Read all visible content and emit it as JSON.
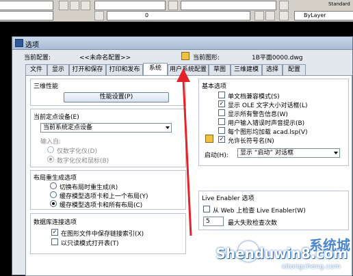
{
  "toolbar": {
    "layer_value": "0",
    "bylayer_label": "ByLayer",
    "standard_fragment": "Standard"
  },
  "dialog": {
    "title": "选项",
    "current_profile_label": "当前配置:",
    "current_profile_value": "<<未命名配置>>",
    "current_drawing_label": "当前图形:",
    "current_drawing_value": "1B平面0000.dwg"
  },
  "tabs": [
    {
      "label": "文件"
    },
    {
      "label": "显示"
    },
    {
      "label": "打开和保存"
    },
    {
      "label": "打印和发布"
    },
    {
      "label": "系统"
    },
    {
      "label": "用户系统配置"
    },
    {
      "label": "草图"
    },
    {
      "label": "三维建模"
    },
    {
      "label": "选择"
    },
    {
      "label": "配置"
    }
  ],
  "active_tab": "系统",
  "performance": {
    "title": "三维性能",
    "button": "性能设置(P)"
  },
  "pointing": {
    "title": "当前定点设备(E)",
    "combo_value": "当前系统定点设备",
    "input_label": "输入自:",
    "opt_digitizer": "仅数字化仪(D)",
    "opt_digitizer_mouse": "数字化仪和鼠标(B)"
  },
  "regen": {
    "title": "布局重生成选项",
    "opt1": "切换布局时重生成(R)",
    "opt2": "缓存模型选项卡和上一个布局(Y)",
    "opt3": "缓存模型选项卡和所有布局(C)"
  },
  "dbconnect": {
    "title": "数据库连接选项",
    "opt1": "在图形文件中保存链接索引(X)",
    "opt2": "以只读模式打开表(T)"
  },
  "general": {
    "title": "基本选项",
    "opt1": "单文档兼容模式(S)",
    "opt2": "显示 OLE 文字大小对话框(L)",
    "opt3": "显示所有警告信息(W)",
    "opt4": "用户输入错误时声音提示(B)",
    "opt5": "每个图形均加载 acad.lsp(V)",
    "opt6": "允许长符号名(N)",
    "startup_label": "启动(H):",
    "startup_value": "显示 “启动” 对话框"
  },
  "live_enabler": {
    "title": "Live Enabler 选项",
    "check_web": "从 Web 上检查 Live Enabler(W)",
    "max_fail_value": "5",
    "max_fail_label": "最大失败检查次数"
  },
  "watermark": {
    "cn": "系统城",
    "big": "Shenduwin8.com",
    "small": "xitongcheng.com"
  },
  "colors": {
    "arrow": "#e3222a",
    "dialog_bg": "#e3e8ef"
  }
}
